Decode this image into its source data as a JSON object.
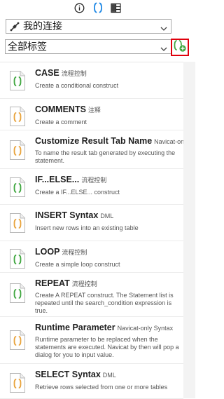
{
  "toolbar": {
    "info_icon": "info-icon",
    "snippet_icon": "braces-icon",
    "grid_icon": "grid-icon"
  },
  "connection": {
    "label": "我的连接"
  },
  "tags": {
    "label": "全部标签"
  },
  "colors": {
    "accent": "#1e88e5",
    "doc_green": "#3fa63f",
    "doc_orange": "#e8a33c",
    "highlight": "#e0000c"
  },
  "snippets": [
    {
      "title": "CASE",
      "tag": "流程控制",
      "desc": "Create a conditional construct",
      "color": "green"
    },
    {
      "title": "COMMENTS",
      "tag": "注释",
      "desc": "Create a comment",
      "color": "orange"
    },
    {
      "title": "Customize Result Tab Name",
      "tag": "Navicat-only",
      "desc": "To name the result tab generated by executing the statement.",
      "color": "orange"
    },
    {
      "title": "IF...ELSE...",
      "tag": "流程控制",
      "desc": "Create a IF...ELSE... construct",
      "color": "green"
    },
    {
      "title": "INSERT Syntax",
      "tag": "DML",
      "desc": "Insert new rows into an existing table",
      "color": "orange"
    },
    {
      "title": "LOOP",
      "tag": "流程控制",
      "desc": "Create a simple loop construct",
      "color": "green"
    },
    {
      "title": "REPEAT",
      "tag": "流程控制",
      "desc": "Create A REPEAT construct. The Statement list is repeated until the search_condition expression is true.",
      "color": "green"
    },
    {
      "title": "Runtime Parameter",
      "tag": "Navicat-only Syntax",
      "desc": "Runtime parameter to be replaced when the statements are executed. Navicat by then will pop a dialog for you to input value.",
      "color": "orange"
    },
    {
      "title": "SELECT Syntax",
      "tag": "DML",
      "desc": "Retrieve rows selected from one or more tables",
      "color": "orange"
    }
  ]
}
